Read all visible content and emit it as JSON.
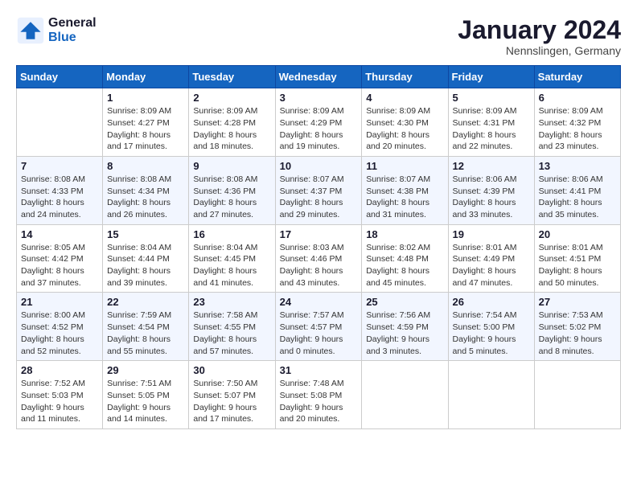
{
  "header": {
    "logo_line1": "General",
    "logo_line2": "Blue",
    "month": "January 2024",
    "location": "Nennslingen, Germany"
  },
  "days_of_week": [
    "Sunday",
    "Monday",
    "Tuesday",
    "Wednesday",
    "Thursday",
    "Friday",
    "Saturday"
  ],
  "weeks": [
    [
      {
        "day": "",
        "info": ""
      },
      {
        "day": "1",
        "info": "Sunrise: 8:09 AM\nSunset: 4:27 PM\nDaylight: 8 hours\nand 17 minutes."
      },
      {
        "day": "2",
        "info": "Sunrise: 8:09 AM\nSunset: 4:28 PM\nDaylight: 8 hours\nand 18 minutes."
      },
      {
        "day": "3",
        "info": "Sunrise: 8:09 AM\nSunset: 4:29 PM\nDaylight: 8 hours\nand 19 minutes."
      },
      {
        "day": "4",
        "info": "Sunrise: 8:09 AM\nSunset: 4:30 PM\nDaylight: 8 hours\nand 20 minutes."
      },
      {
        "day": "5",
        "info": "Sunrise: 8:09 AM\nSunset: 4:31 PM\nDaylight: 8 hours\nand 22 minutes."
      },
      {
        "day": "6",
        "info": "Sunrise: 8:09 AM\nSunset: 4:32 PM\nDaylight: 8 hours\nand 23 minutes."
      }
    ],
    [
      {
        "day": "7",
        "info": "Sunrise: 8:08 AM\nSunset: 4:33 PM\nDaylight: 8 hours\nand 24 minutes."
      },
      {
        "day": "8",
        "info": "Sunrise: 8:08 AM\nSunset: 4:34 PM\nDaylight: 8 hours\nand 26 minutes."
      },
      {
        "day": "9",
        "info": "Sunrise: 8:08 AM\nSunset: 4:36 PM\nDaylight: 8 hours\nand 27 minutes."
      },
      {
        "day": "10",
        "info": "Sunrise: 8:07 AM\nSunset: 4:37 PM\nDaylight: 8 hours\nand 29 minutes."
      },
      {
        "day": "11",
        "info": "Sunrise: 8:07 AM\nSunset: 4:38 PM\nDaylight: 8 hours\nand 31 minutes."
      },
      {
        "day": "12",
        "info": "Sunrise: 8:06 AM\nSunset: 4:39 PM\nDaylight: 8 hours\nand 33 minutes."
      },
      {
        "day": "13",
        "info": "Sunrise: 8:06 AM\nSunset: 4:41 PM\nDaylight: 8 hours\nand 35 minutes."
      }
    ],
    [
      {
        "day": "14",
        "info": "Sunrise: 8:05 AM\nSunset: 4:42 PM\nDaylight: 8 hours\nand 37 minutes."
      },
      {
        "day": "15",
        "info": "Sunrise: 8:04 AM\nSunset: 4:44 PM\nDaylight: 8 hours\nand 39 minutes."
      },
      {
        "day": "16",
        "info": "Sunrise: 8:04 AM\nSunset: 4:45 PM\nDaylight: 8 hours\nand 41 minutes."
      },
      {
        "day": "17",
        "info": "Sunrise: 8:03 AM\nSunset: 4:46 PM\nDaylight: 8 hours\nand 43 minutes."
      },
      {
        "day": "18",
        "info": "Sunrise: 8:02 AM\nSunset: 4:48 PM\nDaylight: 8 hours\nand 45 minutes."
      },
      {
        "day": "19",
        "info": "Sunrise: 8:01 AM\nSunset: 4:49 PM\nDaylight: 8 hours\nand 47 minutes."
      },
      {
        "day": "20",
        "info": "Sunrise: 8:01 AM\nSunset: 4:51 PM\nDaylight: 8 hours\nand 50 minutes."
      }
    ],
    [
      {
        "day": "21",
        "info": "Sunrise: 8:00 AM\nSunset: 4:52 PM\nDaylight: 8 hours\nand 52 minutes."
      },
      {
        "day": "22",
        "info": "Sunrise: 7:59 AM\nSunset: 4:54 PM\nDaylight: 8 hours\nand 55 minutes."
      },
      {
        "day": "23",
        "info": "Sunrise: 7:58 AM\nSunset: 4:55 PM\nDaylight: 8 hours\nand 57 minutes."
      },
      {
        "day": "24",
        "info": "Sunrise: 7:57 AM\nSunset: 4:57 PM\nDaylight: 9 hours\nand 0 minutes."
      },
      {
        "day": "25",
        "info": "Sunrise: 7:56 AM\nSunset: 4:59 PM\nDaylight: 9 hours\nand 3 minutes."
      },
      {
        "day": "26",
        "info": "Sunrise: 7:54 AM\nSunset: 5:00 PM\nDaylight: 9 hours\nand 5 minutes."
      },
      {
        "day": "27",
        "info": "Sunrise: 7:53 AM\nSunset: 5:02 PM\nDaylight: 9 hours\nand 8 minutes."
      }
    ],
    [
      {
        "day": "28",
        "info": "Sunrise: 7:52 AM\nSunset: 5:03 PM\nDaylight: 9 hours\nand 11 minutes."
      },
      {
        "day": "29",
        "info": "Sunrise: 7:51 AM\nSunset: 5:05 PM\nDaylight: 9 hours\nand 14 minutes."
      },
      {
        "day": "30",
        "info": "Sunrise: 7:50 AM\nSunset: 5:07 PM\nDaylight: 9 hours\nand 17 minutes."
      },
      {
        "day": "31",
        "info": "Sunrise: 7:48 AM\nSunset: 5:08 PM\nDaylight: 9 hours\nand 20 minutes."
      },
      {
        "day": "",
        "info": ""
      },
      {
        "day": "",
        "info": ""
      },
      {
        "day": "",
        "info": ""
      }
    ]
  ]
}
